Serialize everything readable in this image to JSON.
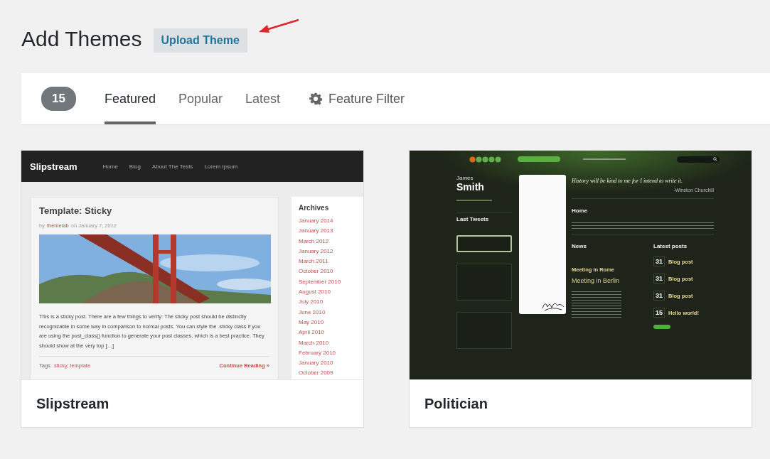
{
  "header": {
    "title": "Add Themes",
    "upload_button": "Upload Theme"
  },
  "filter_bar": {
    "count": "15",
    "tabs": [
      {
        "label": "Featured",
        "selected": true
      },
      {
        "label": "Popular",
        "selected": false
      },
      {
        "label": "Latest",
        "selected": false
      }
    ],
    "feature_filter": "Feature Filter"
  },
  "themes": [
    {
      "name": "Slipstream",
      "kind": "slipstream",
      "preview": {
        "site_title": "Slipstream",
        "nav": [
          "Home",
          "Blog",
          "About The Tests",
          "Lorem Ipsum"
        ],
        "post_title": "Template: Sticky",
        "byline_prefix": "by",
        "author": "themelab",
        "date": "on January 7, 2012",
        "excerpt": "This is a sticky post. There are a few things to verify: The sticky post should be distinctly recognizable in some way in comparison to normal posts. You can style the .sticky class if you are using the post_class() function to generate your post classes, which is a best practice. They should show at the very top […]",
        "tags_label": "Tags:",
        "tags": "sticky, template",
        "continue": "Continue Reading »",
        "archives_title": "Archives",
        "archives": [
          "January 2014",
          "January 2013",
          "March 2012",
          "January 2012",
          "March 2011",
          "October 2010",
          "September 2010",
          "August 2010",
          "July 2010",
          "June 2010",
          "May 2010",
          "April 2010",
          "March 2010",
          "February 2010",
          "January 2010",
          "October 2009"
        ]
      }
    },
    {
      "name": "Politician",
      "kind": "politician",
      "preview": {
        "first_name": "James",
        "last_name": "Smith",
        "tweets_heading": "Last Tweets",
        "quote": "History will be kind to me for I intend to write it.",
        "quote_author": "-Winston Churchill",
        "home_heading": "Home",
        "news_heading": "News",
        "news_item": "Meeting in Rome",
        "featured_title": "Meeting in Berlin",
        "latest_heading": "Latest posts",
        "posts": [
          {
            "day": "31",
            "title": "Blog post"
          },
          {
            "day": "31",
            "title": "Blog post"
          },
          {
            "day": "31",
            "title": "Blog post"
          },
          {
            "day": "15",
            "title": "Hello world!"
          }
        ]
      }
    }
  ]
}
